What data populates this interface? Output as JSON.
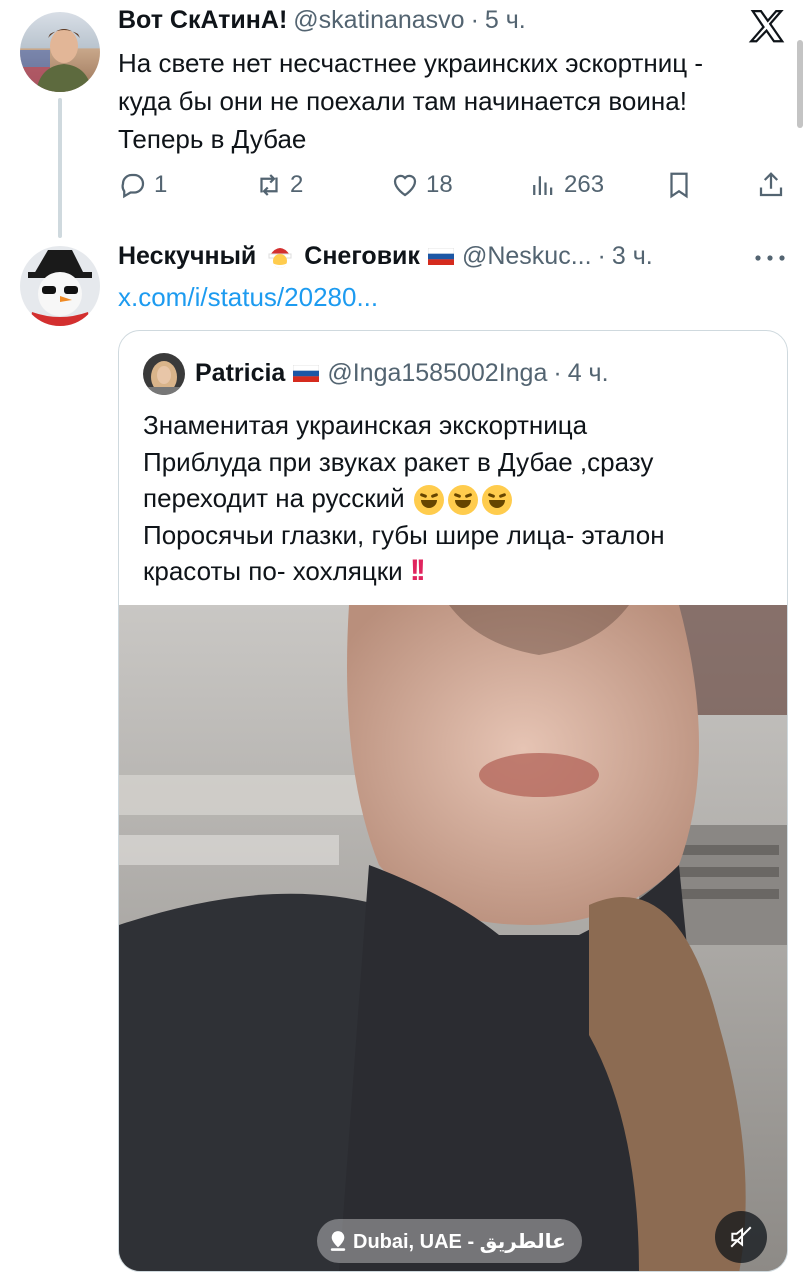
{
  "tweet1": {
    "display_name": "Вот СкАтинА!",
    "handle": "@skatinanasvo",
    "time": "5 ч.",
    "text_lines": [
      "На свете нет несчастнее украинских эскортниц -",
      "куда бы они не поехали там начинается воина!",
      "Теперь в Дубае"
    ],
    "actions": {
      "replies": "1",
      "reposts": "2",
      "likes": "18",
      "views": "263"
    },
    "avatar_icon": "soldier-avatar"
  },
  "tweet2": {
    "display_name_part1": "Нескучный",
    "display_name_part2": "Снеговик",
    "handle": "@Neskuc...",
    "time": "3 ч.",
    "link_text": "x.com/i/status/20280...",
    "avatar_icon": "snowman-avatar"
  },
  "quote": {
    "display_name": "Patricia",
    "handle": "@Inga1585002Inga",
    "time": "4 ч.",
    "text_lines": [
      "Знаменитая украинская экскортница",
      "Приблуда при звуках ракет в Дубае ,сразу",
      "переходит на русский",
      "Поросячьи глазки, губы шире лица- эталон",
      "красоты по- хохляцки"
    ],
    "location_label": "Dubai, UAE - عالطريق",
    "mute_icon": "muted-speaker-icon"
  },
  "separator": "·",
  "logo": "x-logo-icon",
  "colors": {
    "link": "#1d9bf0",
    "muted": "#536471",
    "line": "#cfd9de"
  }
}
